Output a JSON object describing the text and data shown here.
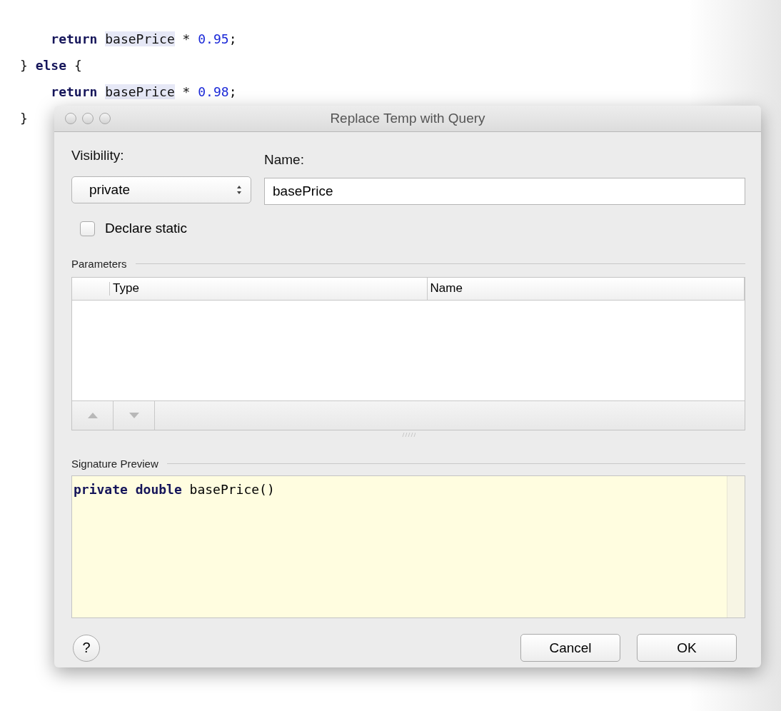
{
  "code_lines": [
    [
      {
        "kind": "keyword",
        "text": "    return "
      },
      {
        "kind": "highlight",
        "text": "basePrice"
      },
      {
        "kind": "plain",
        "text": " * "
      },
      {
        "kind": "number",
        "text": "0.95"
      },
      {
        "kind": "plain",
        "text": ";"
      }
    ],
    [
      {
        "kind": "plain",
        "text": "} "
      },
      {
        "kind": "keyword",
        "text": "else"
      },
      {
        "kind": "plain",
        "text": " {"
      }
    ],
    [
      {
        "kind": "keyword",
        "text": "    return "
      },
      {
        "kind": "highlight",
        "text": "basePrice"
      },
      {
        "kind": "plain",
        "text": " * "
      },
      {
        "kind": "number",
        "text": "0.98"
      },
      {
        "kind": "plain",
        "text": ";"
      }
    ],
    [
      {
        "kind": "plain",
        "text": "}"
      }
    ]
  ],
  "dialog": {
    "title": "Replace Temp with Query",
    "visibility": {
      "label": "Visibility:",
      "value": "private"
    },
    "name": {
      "label": "Name:",
      "value": "basePrice"
    },
    "declare_static": {
      "label": "Declare static",
      "checked": false
    },
    "parameters": {
      "title": "Parameters",
      "columns": [
        "Type",
        "Name"
      ]
    },
    "signature_preview": {
      "title": "Signature Preview",
      "tokens": [
        {
          "kind": "keyword",
          "text": "private "
        },
        {
          "kind": "keyword",
          "text": "double"
        },
        {
          "kind": "plain",
          "text": " basePrice()"
        }
      ]
    },
    "buttons": [
      "Cancel",
      "OK"
    ],
    "help": "?"
  }
}
